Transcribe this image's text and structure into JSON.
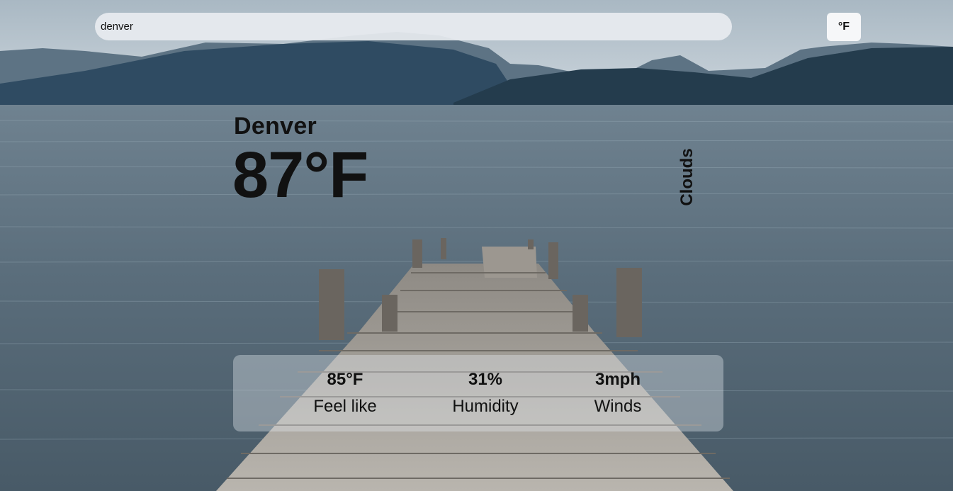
{
  "search": {
    "value": "denver"
  },
  "unit_toggle": {
    "label": "°F"
  },
  "current": {
    "city": "Denver",
    "temperature": "87°F",
    "condition": "Clouds"
  },
  "details": [
    {
      "value": "85°F",
      "label": "Feel like"
    },
    {
      "value": "31%",
      "label": "Humidity"
    },
    {
      "value": "3mph",
      "label": "Winds"
    }
  ],
  "background": {
    "icon": "lake-pier-photo"
  }
}
